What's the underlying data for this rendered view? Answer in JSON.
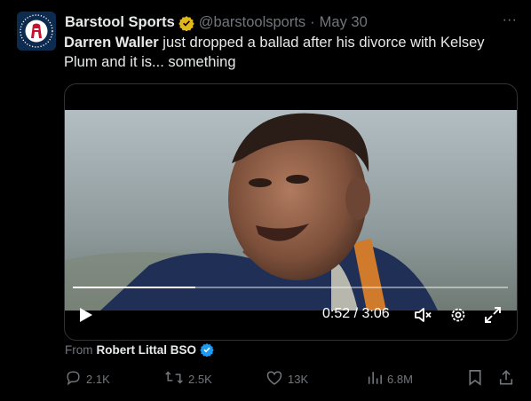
{
  "author": {
    "name": "Barstool Sports",
    "handle": "@barstoolsports",
    "separator": "·",
    "date": "May 30"
  },
  "more_glyph": "···",
  "tweet": {
    "mention": "Darren Waller",
    "text": " just dropped a ballad after his divorce with Kelsey Plum and it is... something"
  },
  "video": {
    "time_readout": "0:52 / 3:06",
    "progress_fraction": 0.282
  },
  "source": {
    "prefix": "From",
    "name": "Robert Littal BSO"
  },
  "actions": {
    "replies": "2.1K",
    "reposts": "2.5K",
    "likes": "13K",
    "views": "6.8M"
  },
  "icons": {
    "avatar": "barstool-logo-icon",
    "verified_author": "gold-verified-badge-icon",
    "verified_source": "blue-verified-badge-icon",
    "play": "play-icon",
    "mute": "muted-speaker-icon",
    "settings": "gear-icon",
    "fullscreen": "expand-icon",
    "reply": "reply-icon",
    "repost": "repost-icon",
    "like": "heart-icon",
    "views": "views-icon",
    "bookmark": "bookmark-icon",
    "share": "share-icon"
  },
  "colors": {
    "background": "#000000",
    "text": "#e7e9ea",
    "muted": "#71767b",
    "gold_badge": "#e2b719",
    "blue_badge": "#1d9bf0",
    "avatar_bg": "#0d2a4f",
    "avatar_logo": "#c8102e"
  }
}
